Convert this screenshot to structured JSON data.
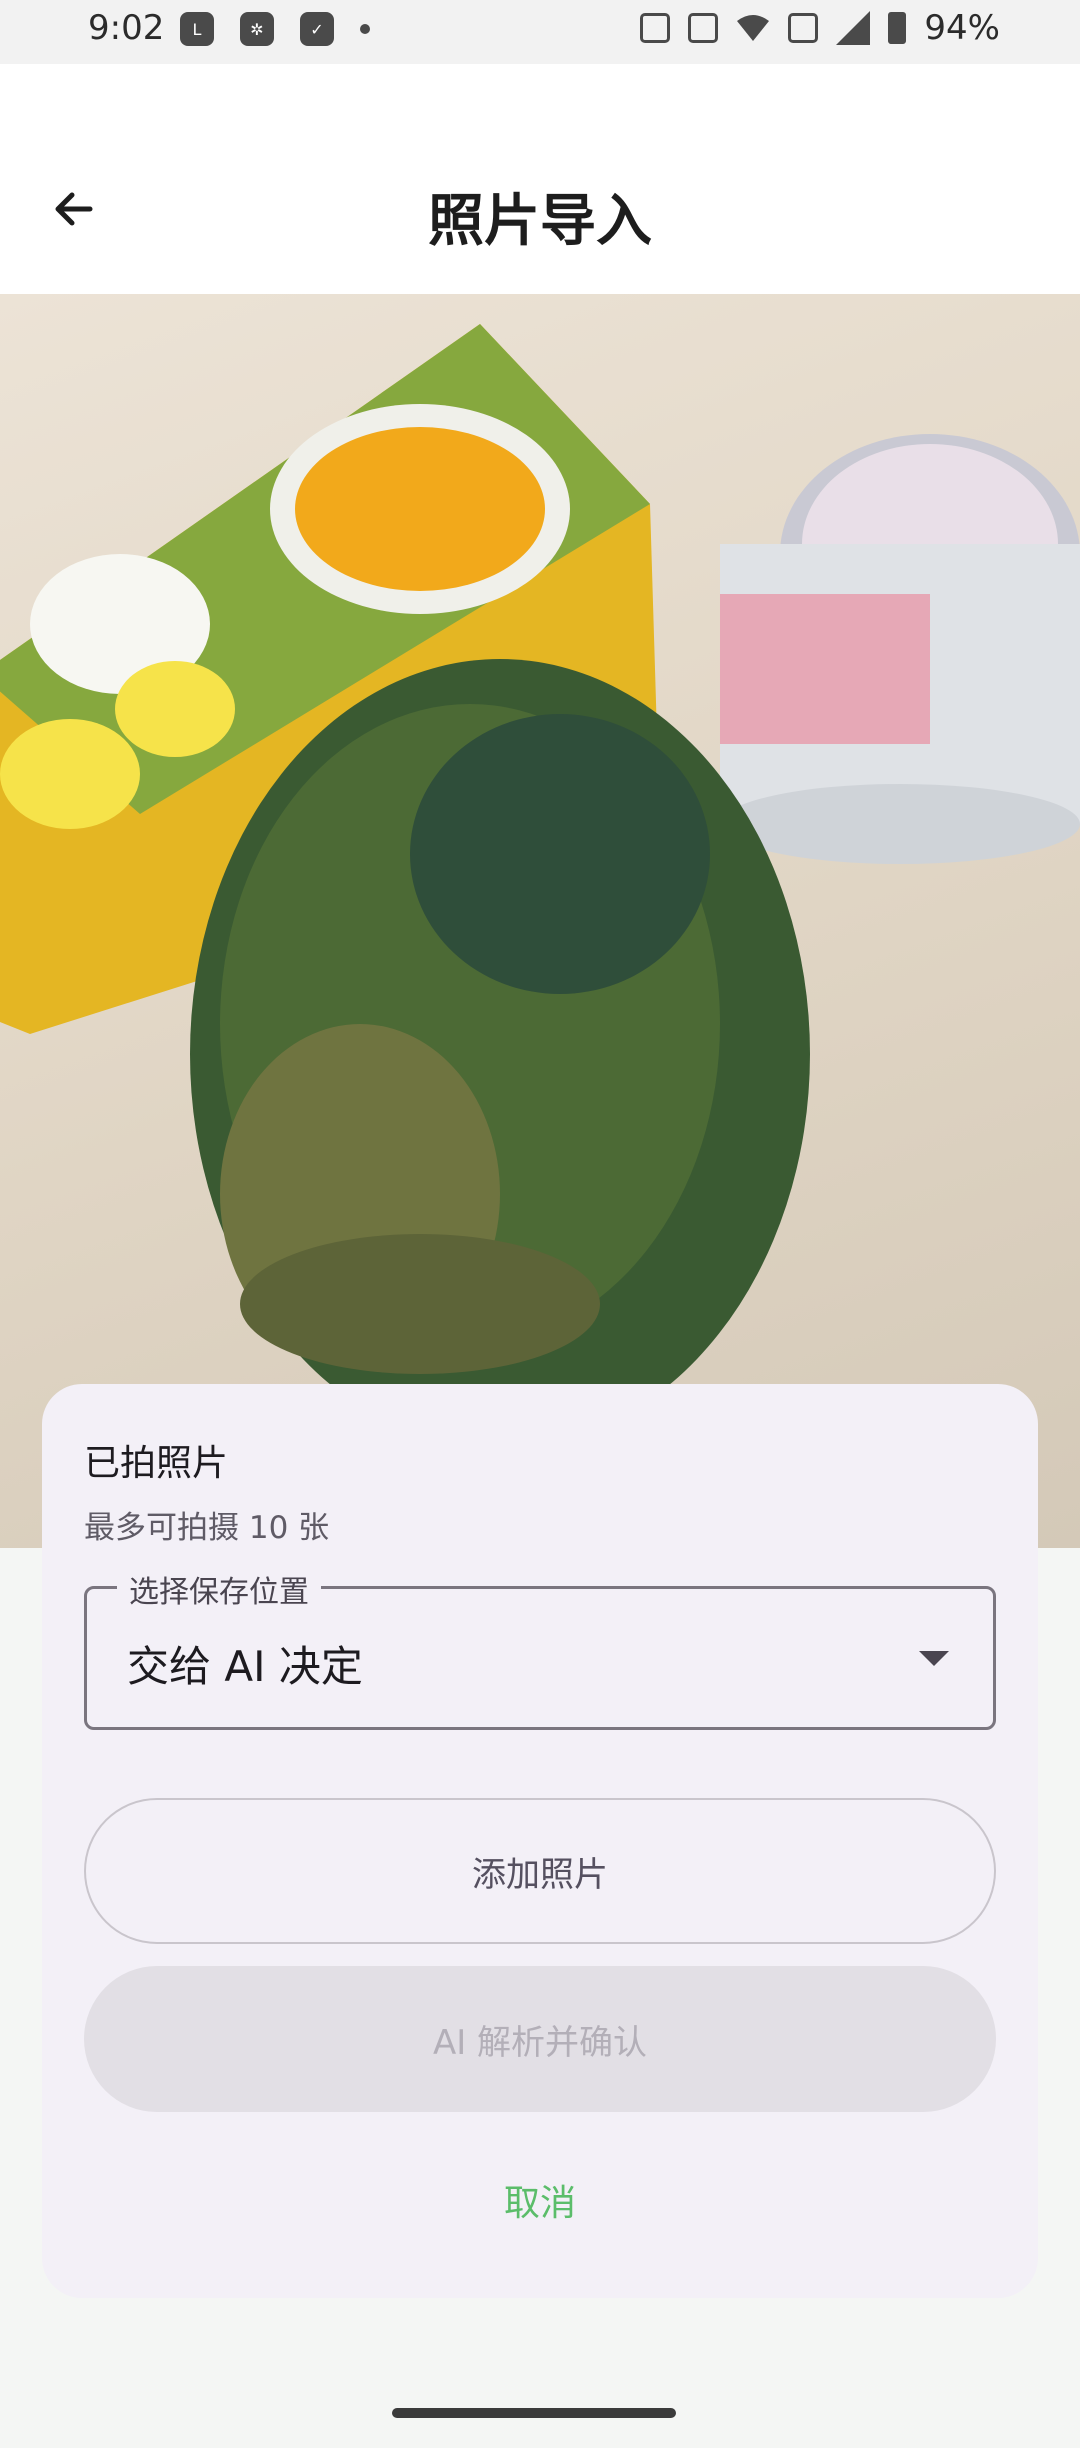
{
  "status_bar": {
    "time": "9:02",
    "battery": "94%",
    "left_icons": [
      "line-app-icon",
      "pinwheel-app-icon",
      "check-app-icon",
      "dot-icon"
    ],
    "right_icons": [
      "auto-hz-icon",
      "vibrate-icon",
      "wifi-icon",
      "volte-icon",
      "signal-icon",
      "battery-icon"
    ]
  },
  "app_bar": {
    "title": "照片导入",
    "back_icon": "arrow-left-icon"
  },
  "sheet": {
    "title": "已拍照片",
    "subtitle": "最多可拍摄 10 张",
    "location": {
      "label": "选择保存位置",
      "value": "交给 AI 决定"
    },
    "add_photo_label": "添加照片",
    "analyze_label": "AI 解析并确认",
    "cancel_label": "取消"
  },
  "colors": {
    "accent_green": "#5bbd6a",
    "sheet_bg": "#f3f0f7",
    "disabled_bg": "#e2dfe5"
  }
}
